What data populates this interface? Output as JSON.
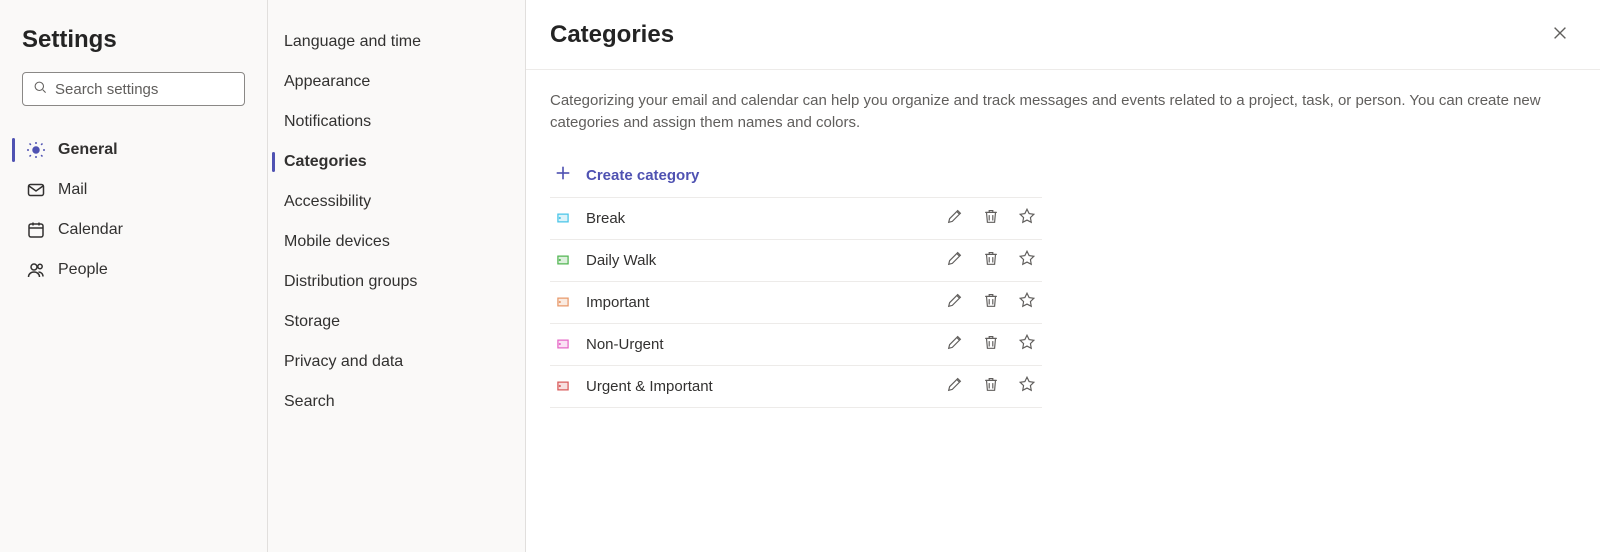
{
  "header": {
    "title": "Settings"
  },
  "search": {
    "placeholder": "Search settings",
    "value": ""
  },
  "primary_nav": {
    "general": "General",
    "mail": "Mail",
    "calendar": "Calendar",
    "people": "People",
    "active": "general"
  },
  "secondary_nav": {
    "items": [
      "Language and time",
      "Appearance",
      "Notifications",
      "Categories",
      "Accessibility",
      "Mobile devices",
      "Distribution groups",
      "Storage",
      "Privacy and data",
      "Search"
    ],
    "active_index": 3
  },
  "main": {
    "title": "Categories",
    "description": "Categorizing your email and calendar can help you organize and track messages and events related to a project, task, or person. You can create new categories and assign them names and colors.",
    "create_label": "Create category",
    "categories": [
      {
        "name": "Break",
        "color": "#49c5e8"
      },
      {
        "name": "Daily Walk",
        "color": "#53b653"
      },
      {
        "name": "Important",
        "color": "#e8996b"
      },
      {
        "name": "Non-Urgent",
        "color": "#e669c7"
      },
      {
        "name": "Urgent & Important",
        "color": "#d95b5b"
      }
    ]
  }
}
